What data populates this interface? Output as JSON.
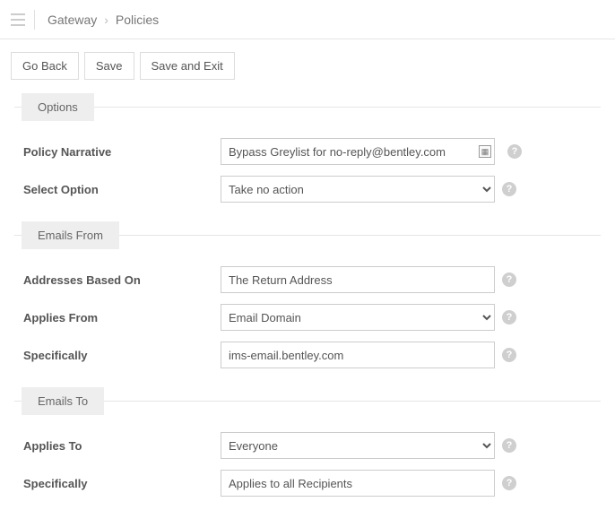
{
  "breadcrumb": {
    "items": [
      "Gateway",
      "Policies"
    ]
  },
  "buttons": {
    "goBack": "Go Back",
    "save": "Save",
    "saveExit": "Save and Exit"
  },
  "sections": {
    "options": {
      "title": "Options",
      "narrative": {
        "label": "Policy Narrative",
        "value": "Bypass Greylist for no-reply@bentley.com"
      },
      "selectOption": {
        "label": "Select Option",
        "value": "Take no action"
      }
    },
    "emailsFrom": {
      "title": "Emails From",
      "addressesBasedOn": {
        "label": "Addresses Based On",
        "value": "The Return Address"
      },
      "appliesFrom": {
        "label": "Applies From",
        "value": "Email Domain"
      },
      "specifically": {
        "label": "Specifically",
        "value": "ims-email.bentley.com"
      }
    },
    "emailsTo": {
      "title": "Emails To",
      "appliesTo": {
        "label": "Applies To",
        "value": "Everyone"
      },
      "specifically": {
        "label": "Specifically",
        "value": "Applies to all Recipients"
      }
    }
  }
}
